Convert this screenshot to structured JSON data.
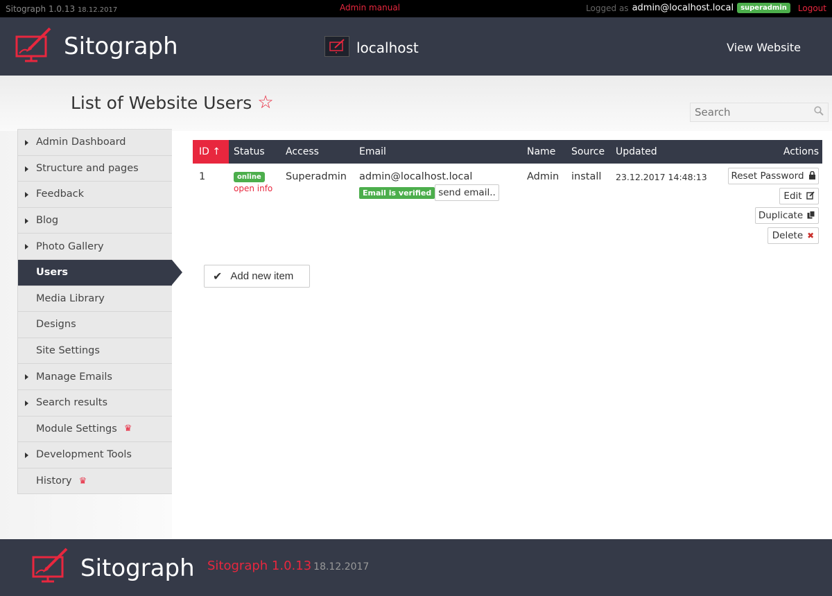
{
  "topbar": {
    "app_version": "Sitograph 1.0.13",
    "app_date": "18.12.2017",
    "admin_manual": "Admin manual",
    "logged_as": "Logged as",
    "user_email": "admin@localhost.local",
    "role_badge": "superadmin",
    "logout": "Logout"
  },
  "header": {
    "brand": "Sitograph",
    "site_name": "localhost",
    "view_website": "View Website"
  },
  "page": {
    "title": "List of Website Users",
    "search_placeholder": "Search"
  },
  "sidebar": {
    "items": [
      {
        "label": "Admin Dashboard",
        "arrow": true
      },
      {
        "label": "Structure and pages",
        "arrow": true
      },
      {
        "label": "Feedback",
        "arrow": true
      },
      {
        "label": "Blog",
        "arrow": true
      },
      {
        "label": "Photo Gallery",
        "arrow": true
      },
      {
        "label": "Users",
        "arrow": false,
        "active": true
      },
      {
        "label": "Media Library",
        "arrow": false
      },
      {
        "label": "Designs",
        "arrow": false
      },
      {
        "label": "Site Settings",
        "arrow": false
      },
      {
        "label": "Manage Emails",
        "arrow": true
      },
      {
        "label": "Search results",
        "arrow": true
      },
      {
        "label": "Module Settings",
        "arrow": false,
        "crown": true
      },
      {
        "label": "Development Tools",
        "arrow": true
      },
      {
        "label": "History",
        "arrow": false,
        "crown": true
      }
    ]
  },
  "table": {
    "columns": [
      "ID ↑",
      "Status",
      "Access",
      "Email",
      "Name",
      "Source",
      "Updated",
      "Actions"
    ],
    "rows": [
      {
        "id": "1",
        "status": "online",
        "open_info": "open info",
        "access": "Superadmin",
        "email": "admin@localhost.local",
        "email_verified": "Email is verified",
        "send_email": "send email..",
        "name": "Admin",
        "source": "install",
        "updated": "23.12.2017 14:48:13"
      }
    ],
    "actions": [
      "Reset Password",
      "Edit",
      "Duplicate",
      "Delete"
    ]
  },
  "add_new_item": "Add new item",
  "footer": {
    "brand": "Sitograph",
    "version": "Sitograph 1.0.13",
    "date": "18.12.2017"
  },
  "colors": {
    "accent": "#e8273e",
    "dark": "#353a48",
    "success": "#4cae4c"
  }
}
